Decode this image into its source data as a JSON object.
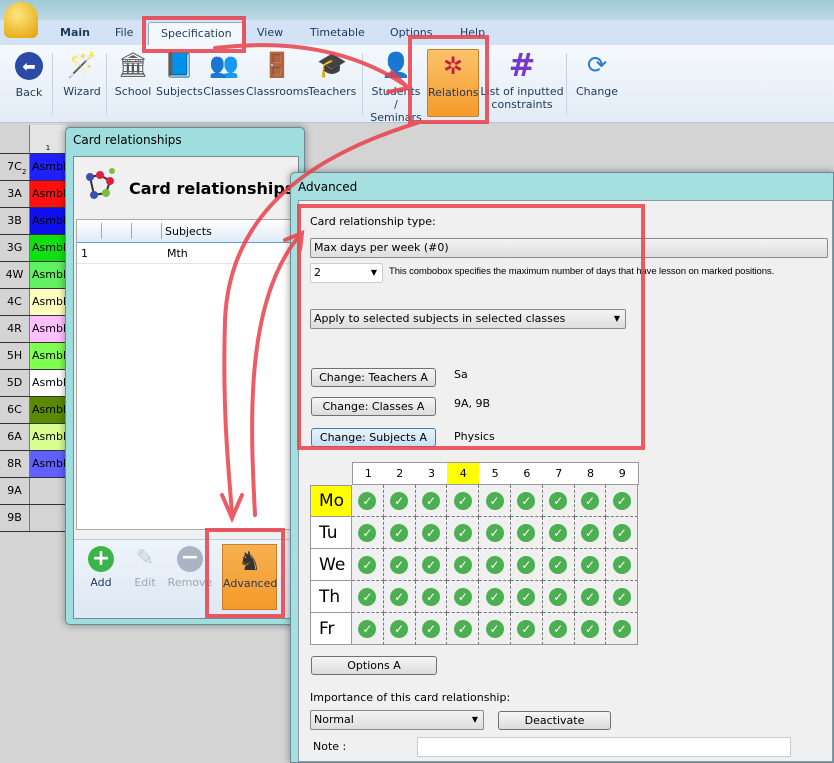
{
  "app": {
    "logo_text": "aSc"
  },
  "menu_tabs": [
    {
      "label": "Main"
    },
    {
      "label": "File"
    },
    {
      "label": "Specification",
      "selected": true
    },
    {
      "label": "View"
    },
    {
      "label": "Timetable"
    },
    {
      "label": "Options"
    },
    {
      "label": "Help"
    }
  ],
  "ribbon": [
    {
      "label": "Back",
      "icon": "back-arrow-icon"
    },
    {
      "label": "Wizard",
      "icon": "magic-wand-icon"
    },
    {
      "label": "School",
      "icon": "school-building-icon"
    },
    {
      "label": "Subjects",
      "icon": "notebook-icon"
    },
    {
      "label": "Classes",
      "icon": "people-icon"
    },
    {
      "label": "Classrooms",
      "icon": "door-icon"
    },
    {
      "label": "Teachers",
      "icon": "graduation-cap-icon"
    },
    {
      "label": "Students /",
      "label2": "Seminars",
      "icon": "student-check-icon"
    },
    {
      "label": "Relations",
      "icon": "molecule-icon",
      "active": true
    },
    {
      "label": "List of inputted",
      "label2": "constraints",
      "icon": "hash-icon"
    },
    {
      "label": "Change",
      "icon": "user-refresh-icon"
    }
  ],
  "timetable_grid": {
    "header_period": "1",
    "rows": [
      {
        "class": "7C",
        "sub": "2",
        "cell": "Asmbly",
        "color": "#2020ff"
      },
      {
        "class": "3A",
        "cell": "Asmbly",
        "color": "#ff1010"
      },
      {
        "class": "3B",
        "cell": "Asmbly",
        "color": "#1010ee"
      },
      {
        "class": "3G",
        "cell": "Asmbly",
        "color": "#10e010"
      },
      {
        "class": "4W",
        "cell": "Asmbly",
        "color": "#60f060"
      },
      {
        "class": "4C",
        "cell": "Asmbly",
        "color": "#ffffc0"
      },
      {
        "class": "4R",
        "cell": "Asmbly",
        "color": "#ffc0ff"
      },
      {
        "class": "5H",
        "cell": "Asmbly",
        "color": "#80ff50"
      },
      {
        "class": "5D",
        "cell": "Asmbly",
        "color": "#ffffff"
      },
      {
        "class": "6C",
        "cell": "Asmbly",
        "color": "#5a8a00"
      },
      {
        "class": "6A",
        "cell": "Asmbly",
        "color": "#d8ff90"
      },
      {
        "class": "8R",
        "cell": "Asmbly",
        "color": "#6060ff"
      },
      {
        "class": "9A",
        "cell": "",
        "color": "#d4d4d4"
      },
      {
        "class": "9B",
        "cell": "",
        "color": "#d4d4d4"
      }
    ]
  },
  "card_window": {
    "title": "Card relationships",
    "heading": "Card relationships",
    "table": {
      "columns": [
        "",
        "",
        "",
        "Subjects"
      ],
      "rows": [
        {
          "num": "1",
          "subjects": "Mth"
        }
      ]
    },
    "toolbar": [
      {
        "label": "Add",
        "icon": "plus-circle-icon",
        "enabled": true
      },
      {
        "label": "Edit",
        "icon": "pencil-icon",
        "enabled": false
      },
      {
        "label": "Remove",
        "icon": "minus-circle-icon",
        "enabled": false
      },
      {
        "label": "Advanced",
        "icon": "chess-knight-plus-icon",
        "enabled": true,
        "active": true
      }
    ]
  },
  "advanced": {
    "title": "Advanced",
    "type_label": "Card relationship type:",
    "type_value": "Max days per week (#0)",
    "count_value": "2",
    "count_desc": "This combobox specifies the maximum number of days that have lesson on marked positions.",
    "apply_value": "Apply to selected subjects in selected classes",
    "teachers_btn": "Change: Teachers A",
    "teachers_val": "Sa",
    "classes_btn": "Change: Classes A",
    "classes_val": "9A, 9B",
    "subjects_btn": "Change: Subjects A",
    "subjects_val": "Physics",
    "periods": [
      "1",
      "2",
      "3",
      "4",
      "5",
      "6",
      "7",
      "8",
      "9"
    ],
    "highlight_period": "4",
    "days": [
      "Mo",
      "Tu",
      "We",
      "Th",
      "Fr"
    ],
    "highlight_day": "Mo",
    "all_checked": true,
    "options_btn": "Options A",
    "importance_label": "Importance of this card relationship:",
    "importance_value": "Normal",
    "deactivate_btn": "Deactivate",
    "note_label": "Note :",
    "note_value": ""
  },
  "colors": {
    "annotation": "#e8404a",
    "active_orange": "#f7a640",
    "check_green": "#4caf50",
    "highlight": "#ffff00"
  }
}
